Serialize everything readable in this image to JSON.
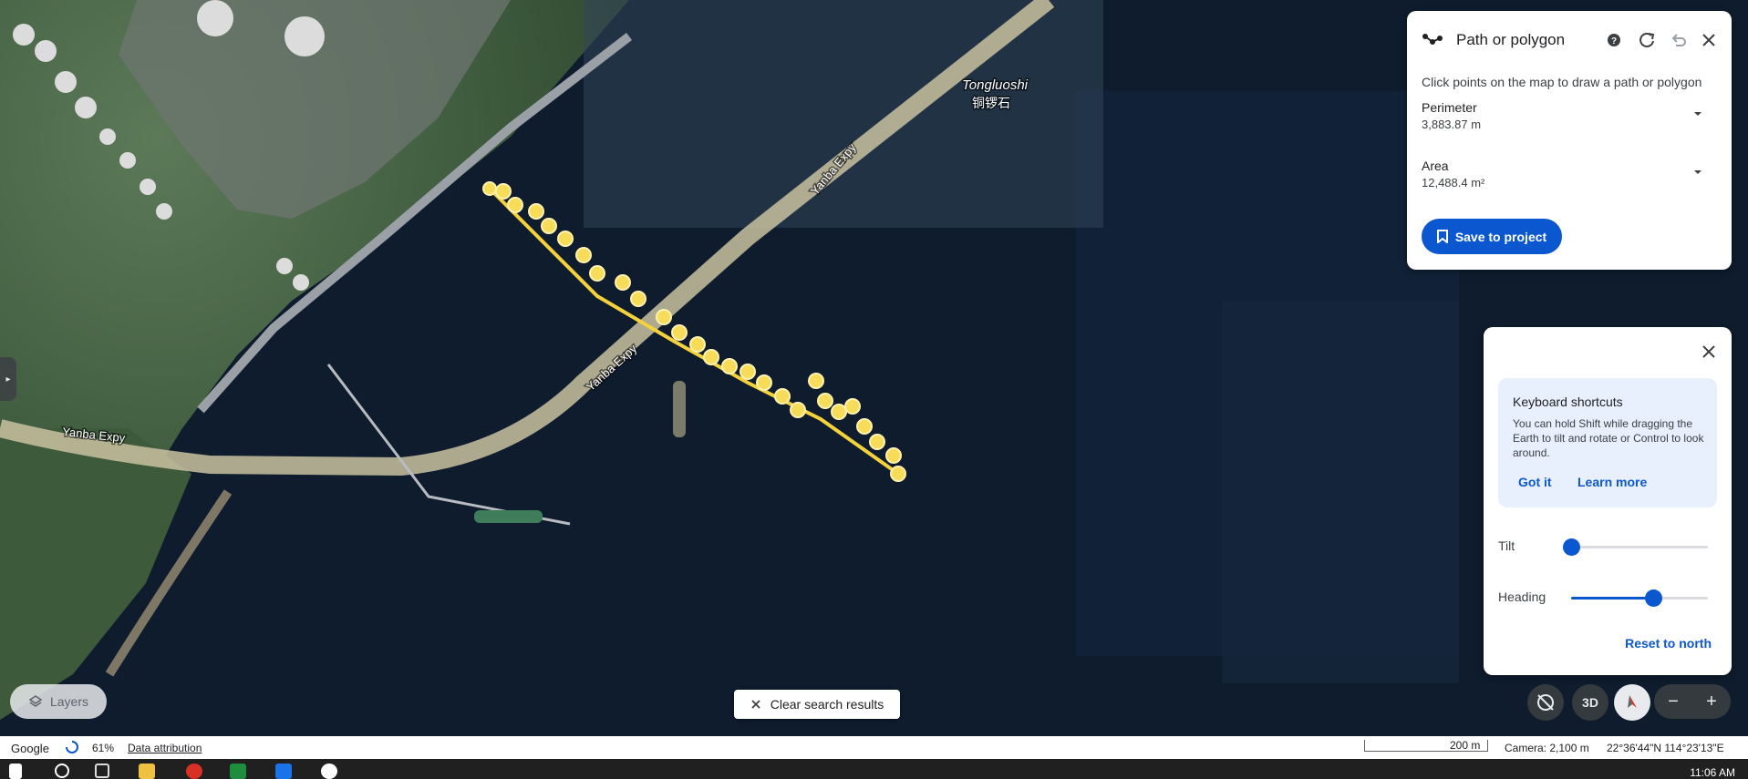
{
  "map": {
    "place_name_latin": "Tongluoshi",
    "place_name_cjk": "铜锣石",
    "road_labels": [
      "Yanba Expy",
      "Yanba Expy",
      "Yanba Expy"
    ]
  },
  "measure_panel": {
    "title": "Path or polygon",
    "help_icon": "help-icon",
    "description": "Click points on the map to draw a path or polygon",
    "perimeter_label": "Perimeter",
    "perimeter_value": "3,883.87 m",
    "area_label": "Area",
    "area_value": "12,488.4 m²",
    "save_label": "Save to project"
  },
  "nav_panel": {
    "shortcuts_title": "Keyboard shortcuts",
    "shortcuts_body": "You can hold Shift while dragging the Earth to tilt and rotate or Control to look around.",
    "got_it": "Got it",
    "learn_more": "Learn more",
    "tilt_label": "Tilt",
    "tilt_value": 0.0,
    "heading_label": "Heading",
    "heading_value": 0.6,
    "reset_label": "Reset to north"
  },
  "controls": {
    "layers_label": "Layers",
    "clear_label": "Clear search results",
    "btn_3d": "3D",
    "zoom_out": "−",
    "zoom_in": "+"
  },
  "status": {
    "brand": "Google",
    "progress": "61%",
    "attribution": "Data attribution",
    "scale": "200 m",
    "camera": "Camera: 2,100 m",
    "coords": "22°36'44\"N 114°23'13\"E"
  },
  "taskbar": {
    "time": "11:06 AM"
  },
  "colors": {
    "accent": "#0b57d0",
    "path_marker": "#f5d23c",
    "water": "#0c1a2b"
  }
}
